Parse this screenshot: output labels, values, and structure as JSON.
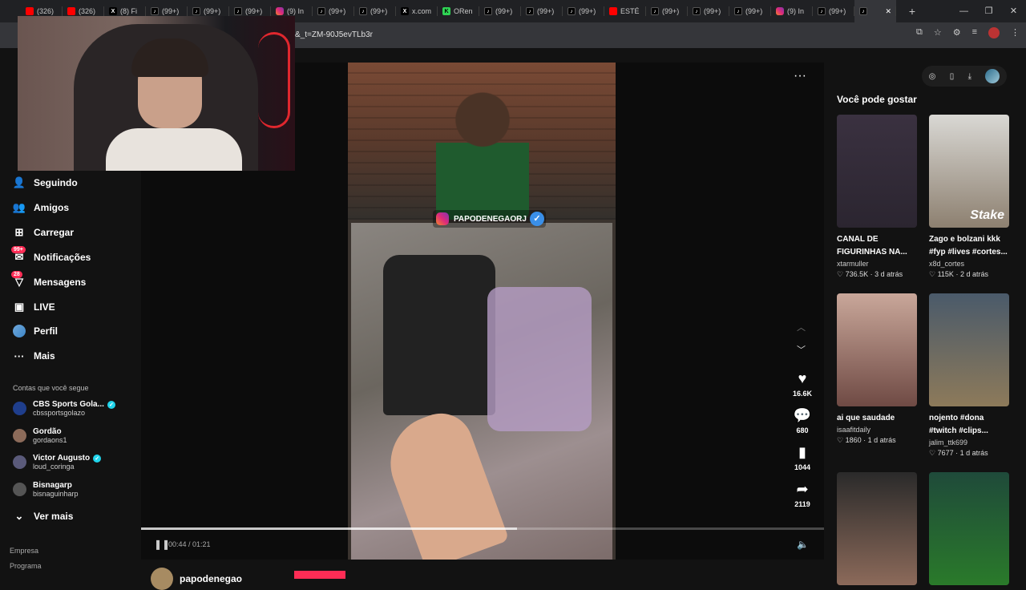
{
  "browser": {
    "tabs": [
      {
        "label": "(326)",
        "fav": "yt",
        "glyph": ""
      },
      {
        "label": "(326)",
        "fav": "yt",
        "glyph": ""
      },
      {
        "label": "(8) Fi",
        "fav": "x",
        "glyph": "X"
      },
      {
        "label": "(99+)",
        "fav": "tt",
        "glyph": "♪"
      },
      {
        "label": "(99+)",
        "fav": "tt",
        "glyph": "♪"
      },
      {
        "label": "(99+)",
        "fav": "tt",
        "glyph": "♪"
      },
      {
        "label": "(9) In",
        "fav": "ig",
        "glyph": ""
      },
      {
        "label": "(99+)",
        "fav": "tt",
        "glyph": "♪"
      },
      {
        "label": "(99+)",
        "fav": "tt",
        "glyph": "♪"
      },
      {
        "label": "x.com",
        "fav": "x",
        "glyph": "X"
      },
      {
        "label": "ORen",
        "fav": "k",
        "glyph": "K"
      },
      {
        "label": "(99+)",
        "fav": "tt",
        "glyph": "♪"
      },
      {
        "label": "(99+)",
        "fav": "tt",
        "glyph": "♪"
      },
      {
        "label": "(99+)",
        "fav": "tt",
        "glyph": "♪"
      },
      {
        "label": "ESTÉ",
        "fav": "yt",
        "glyph": ""
      },
      {
        "label": "(99+)",
        "fav": "tt",
        "glyph": "♪"
      },
      {
        "label": "(99+)",
        "fav": "tt",
        "glyph": "♪"
      },
      {
        "label": "(99+)",
        "fav": "tt",
        "glyph": "♪"
      },
      {
        "label": "(9) In",
        "fav": "ig",
        "glyph": ""
      },
      {
        "label": "(99+)",
        "fav": "tt",
        "glyph": "♪"
      },
      {
        "label": "",
        "fav": "tt",
        "glyph": "♪",
        "active": true
      }
    ],
    "url": "&_t=ZM-90J5evTLb3r"
  },
  "sidebar": {
    "items": [
      {
        "label": "Seguindo",
        "icon": "following-icon",
        "glyph": "👤"
      },
      {
        "label": "Amigos",
        "icon": "friends-icon",
        "glyph": "👥"
      },
      {
        "label": "Carregar",
        "icon": "upload-icon",
        "glyph": "⊞"
      },
      {
        "label": "Notificações",
        "icon": "notifications-icon",
        "glyph": "✉",
        "badge": "99+"
      },
      {
        "label": "Mensagens",
        "icon": "messages-icon",
        "glyph": "▽",
        "badge": "28"
      },
      {
        "label": "LIVE",
        "icon": "live-icon",
        "glyph": "▣"
      },
      {
        "label": "Perfil",
        "icon": "profile-avatar",
        "glyph": ""
      },
      {
        "label": "Mais",
        "icon": "more-icon",
        "glyph": "···"
      }
    ],
    "following_title": "Contas que você segue",
    "accounts": [
      {
        "name": "CBS Sports Gola...",
        "handle": "cbssportsgolazo",
        "verified": true,
        "color": "#1f3e8c"
      },
      {
        "name": "Gordão",
        "handle": "gordaons1",
        "verified": false,
        "color": "#8c6b5a"
      },
      {
        "name": "Victor Augusto",
        "handle": "loud_coringa",
        "verified": true,
        "color": "#5a5a7a"
      },
      {
        "name": "Bisnagarp",
        "handle": "bisnaguinharp",
        "verified": false,
        "color": "#555"
      }
    ],
    "see_more": "Ver mais",
    "footer": [
      "Empresa",
      "Programa"
    ]
  },
  "video": {
    "overlay_tag": "PAPODENEGAORJ",
    "likes": "16.6K",
    "comments": "680",
    "saves": "1044",
    "shares": "2119",
    "time": "00:44 / 01:21",
    "progress": 0.55,
    "author": "papodenegao"
  },
  "right_panel": {
    "title": "Você pode gostar",
    "cards": [
      {
        "title": "CANAL DE FIGURINHAS NA...",
        "author": "xtarmuller",
        "likes": "736.5K",
        "ago": "3 d atrás",
        "bg": "linear-gradient(180deg,#3a3140,#2b2530)",
        "overlay": ""
      },
      {
        "title": "Zago e bolzani kkk #fyp #lives #cortes...",
        "author": "x8d_cortes",
        "likes": "115K",
        "ago": "2 d atrás",
        "bg": "linear-gradient(180deg,#d9d8d4,#8d8070)",
        "overlay": "Stake"
      },
      {
        "title": "ai que saudade",
        "author": "isaafitdaily",
        "likes": "1860",
        "ago": "1 d atrás",
        "bg": "linear-gradient(180deg,#c9a79a,#6f4a44)",
        "overlay": ""
      },
      {
        "title": "nojento #dona #twitch #clips...",
        "author": "jalim_ttk699",
        "likes": "7677",
        "ago": "1 d atrás",
        "bg": "linear-gradient(180deg,#4a5a6a,#8d7a5a)",
        "overlay": ""
      },
      {
        "title": "",
        "author": "",
        "likes": "",
        "ago": "",
        "bg": "linear-gradient(180deg,#2a2a2a,#8c6a5a)",
        "overlay": ""
      },
      {
        "title": "",
        "author": "",
        "likes": "",
        "ago": "",
        "bg": "linear-gradient(180deg,#1f4a3a,#2a7a2a)",
        "overlay": ""
      }
    ]
  }
}
